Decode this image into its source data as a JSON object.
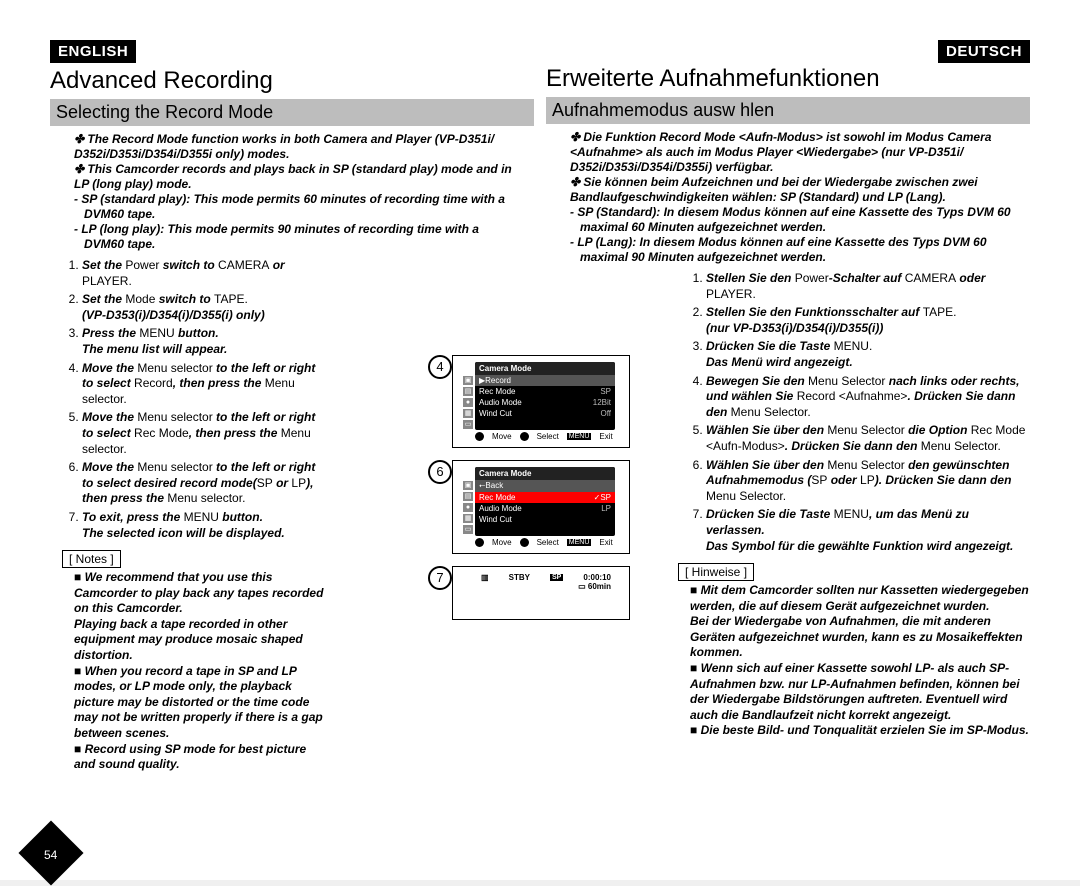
{
  "page_number": "54",
  "english": {
    "lang": "ENGLISH",
    "title": "Advanced Recording",
    "subtitle": "Selecting the Record Mode",
    "intro_line1": "The Record Mode function works in both Camera and Player (VP-D351i/ D352i/D353i/D354i/D355i only) modes.",
    "intro_line2": "This Camcorder records and plays back in SP (standard play) mode and in LP (long play) mode.",
    "intro_dash1": "SP (standard play): This mode permits 60 minutes of recording time with a DVM60 tape.",
    "intro_dash2": "LP (long play): This mode permits 90 minutes of recording time with a DVM60 tape.",
    "step1_a": "Set the ",
    "step1_b": "Power",
    "step1_c": " switch to ",
    "step1_d": "CAMERA",
    "step1_e": " or ",
    "step1_f": "PLAYER",
    "step1_g": ".",
    "step2_a": "Set the ",
    "step2_b": "Mode",
    "step2_c": " switch to ",
    "step2_d": "TAPE",
    "step2_e": ".",
    "step2_sub": "(VP-D353(i)/D354(i)/D355(i) only)",
    "step3_a": "Press the ",
    "step3_b": "MENU",
    "step3_c": " button.",
    "step3_sub": "The menu list will appear.",
    "step4_a": "Move the ",
    "step4_b": "Menu selector",
    "step4_c": " to the left or right to select ",
    "step4_d": "Record",
    "step4_e": ", then press the ",
    "step4_f": "Menu selector",
    "step4_g": ".",
    "step5_a": "Move the ",
    "step5_b": "Menu selector",
    "step5_c": " to the left or right to select ",
    "step5_d": "Rec Mode",
    "step5_e": ", then press the ",
    "step5_f": "Menu selector",
    "step5_g": ".",
    "step6_a": "Move the ",
    "step6_b": "Menu selector",
    "step6_c": " to the left or right to select desired record mode(",
    "step6_d": "SP",
    "step6_e": " or ",
    "step6_f": "LP",
    "step6_g": "), then press the ",
    "step6_h": "Menu selector",
    "step6_i": ".",
    "step7_a": "To exit, press the ",
    "step7_b": "MENU",
    "step7_c": " button.",
    "step7_sub": "The selected icon will be displayed.",
    "notes_label": "[ Notes ]",
    "note1": "We recommend that you use this Camcorder to play back any tapes recorded on this Camcorder.",
    "note1b": "Playing back a tape recorded in other equipment may produce mosaic shaped distortion.",
    "note2": "When you record a tape in SP and LP modes, or LP mode only, the playback picture may be distorted or the time code may not be written properly if there is a gap between scenes.",
    "note3": "Record using SP mode for best picture and sound quality."
  },
  "deutsch": {
    "lang": "DEUTSCH",
    "title": "Erweiterte Aufnahmefunktionen",
    "subtitle": "Aufnahmemodus ausw hlen",
    "intro_line1": "Die Funktion Record Mode <Aufn-Modus> ist sowohl im Modus Camera <Aufnahme> als auch im Modus Player <Wiedergabe> (nur VP-D351i/ D352i/D353i/D354i/D355i) verfügbar.",
    "intro_line2": "Sie können beim Aufzeichnen und bei der Wiedergabe zwischen zwei Bandlaufgeschwindigkeiten wählen: SP (Standard) und LP (Lang).",
    "intro_dash1": "SP (Standard): In diesem Modus können auf eine Kassette des Typs DVM 60 maximal 60 Minuten aufgezeichnet werden.",
    "intro_dash2": "LP (Lang): In diesem Modus können auf eine Kassette des Typs DVM 60 maximal 90 Minuten aufgezeichnet werden.",
    "step1_a": "Stellen Sie den ",
    "step1_b": "Power",
    "step1_c": "-Schalter auf ",
    "step1_d": "CAMERA",
    "step1_e": " oder ",
    "step1_f": "PLAYER",
    "step1_g": ".",
    "step2_a": "Stellen Sie den Funktionsschalter auf ",
    "step2_b": "TAPE",
    "step2_c": ".",
    "step2_sub": "(nur VP-D353(i)/D354(i)/D355(i))",
    "step3_a": "Drücken Sie die Taste ",
    "step3_b": "MENU",
    "step3_c": ".",
    "step3_sub": "Das Menü wird angezeigt.",
    "step4_a": "Bewegen Sie den ",
    "step4_b": "Menu Selector",
    "step4_c": " nach links oder rechts, und wählen Sie ",
    "step4_d": "Record <Aufnahme>",
    "step4_e": ". Drücken Sie dann den ",
    "step4_f": "Menu Selector",
    "step4_g": ".",
    "step5_a": "Wählen Sie über den ",
    "step5_b": "Menu Selector",
    "step5_c": " die Option ",
    "step5_d": "Rec Mode <Aufn-Modus>",
    "step5_e": ". Drücken Sie dann den ",
    "step5_f": "Menu Selector",
    "step5_g": ".",
    "step6_a": "Wählen Sie über den ",
    "step6_b": "Menu Selector",
    "step6_c": " den gewünschten Aufnahmemodus (",
    "step6_d": "SP",
    "step6_e": " oder ",
    "step6_f": "LP",
    "step6_g": "). Drücken Sie dann den ",
    "step6_h": "Menu Selector",
    "step6_i": ".",
    "step7_a": "Drücken Sie die Taste ",
    "step7_b": "MENU",
    "step7_c": ", um das Menü zu verlassen.",
    "step7_sub": "Das Symbol für die gewählte Funktion wird angezeigt.",
    "notes_label": "[ Hinweise ]",
    "note1": "Mit dem Camcorder sollten nur Kassetten wiedergegeben werden, die auf diesem Gerät aufgezeichnet wurden.",
    "note1b": "Bei der Wiedergabe von Aufnahmen, die mit anderen Geräten aufgezeichnet wurden, kann es zu Mosaikeffekten kommen.",
    "note2": "Wenn sich auf einer Kassette sowohl LP- als auch SP-Aufnahmen bzw. nur LP-Aufnahmen befinden, können bei der Wiedergabe Bildstörungen auftreten. Eventuell wird auch die Bandlaufzeit nicht korrekt angezeigt.",
    "note3": "Die beste Bild- und Tonqualität erzielen Sie im SP-Modus."
  },
  "fig4": {
    "num": "4",
    "title": "Camera Mode",
    "row_record": "Record",
    "r1": "Rec Mode",
    "v1": "SP",
    "r2": "Audio Mode",
    "v2": "12Bit",
    "r3": "Wind Cut",
    "v3": "Off",
    "nav_move": "Move",
    "nav_select": "Select",
    "nav_menu": "MENU",
    "nav_exit": "Exit"
  },
  "fig6": {
    "num": "6",
    "title": "Camera Mode",
    "row_back": "Back",
    "r1": "Rec Mode",
    "v1": "SP",
    "r2": "Audio Mode",
    "v2": "LP",
    "r3": "Wind Cut",
    "nav_move": "Move",
    "nav_select": "Select",
    "nav_menu": "MENU",
    "nav_exit": "Exit"
  },
  "fig7": {
    "num": "7",
    "stby": "STBY",
    "sp": "SP",
    "time": "0:00:10",
    "remain": "60min"
  }
}
